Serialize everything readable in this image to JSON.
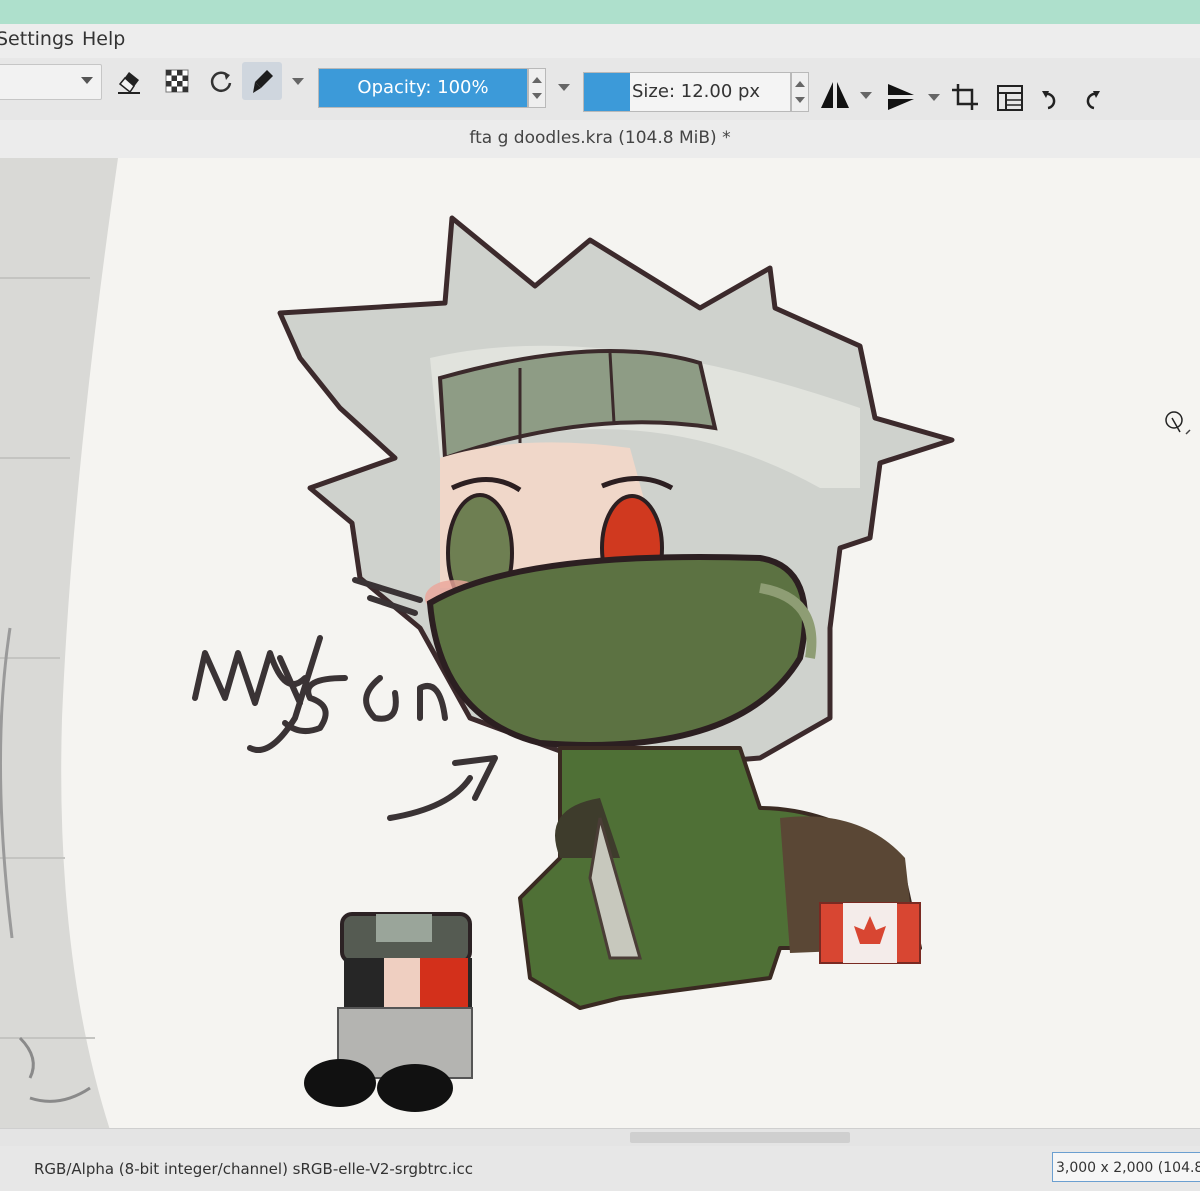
{
  "menu": {
    "settings": "Settings",
    "help": "Help"
  },
  "toolbar": {
    "opacity_label": "Opacity:  100%",
    "opacity_value": 100,
    "size_label": "Size: 12.00 px",
    "icons": [
      "eraser-icon",
      "alpha-checker-icon",
      "reload-preset-icon",
      "brush-preset-icon",
      "mirror-horizontal-icon",
      "mirror-vertical-icon",
      "crop-icon",
      "wrap-around-icon",
      "undo-icon",
      "redo-icon"
    ]
  },
  "document": {
    "title": "fta g doodles.kra (104.8 MiB) *"
  },
  "canvas": {
    "handwriting_line1": "my",
    "handwriting_line2": "son"
  },
  "statusbar": {
    "color_profile": "RGB/Alpha (8-bit integer/channel)  sRGB-elle-V2-srgbtrc.icc",
    "image_size": "3,000 x 2,000 (104.8"
  },
  "colors": {
    "accent": "#3c9ad9",
    "canvas": "#f5f4f1",
    "toolbar": "#e7e7e7"
  }
}
